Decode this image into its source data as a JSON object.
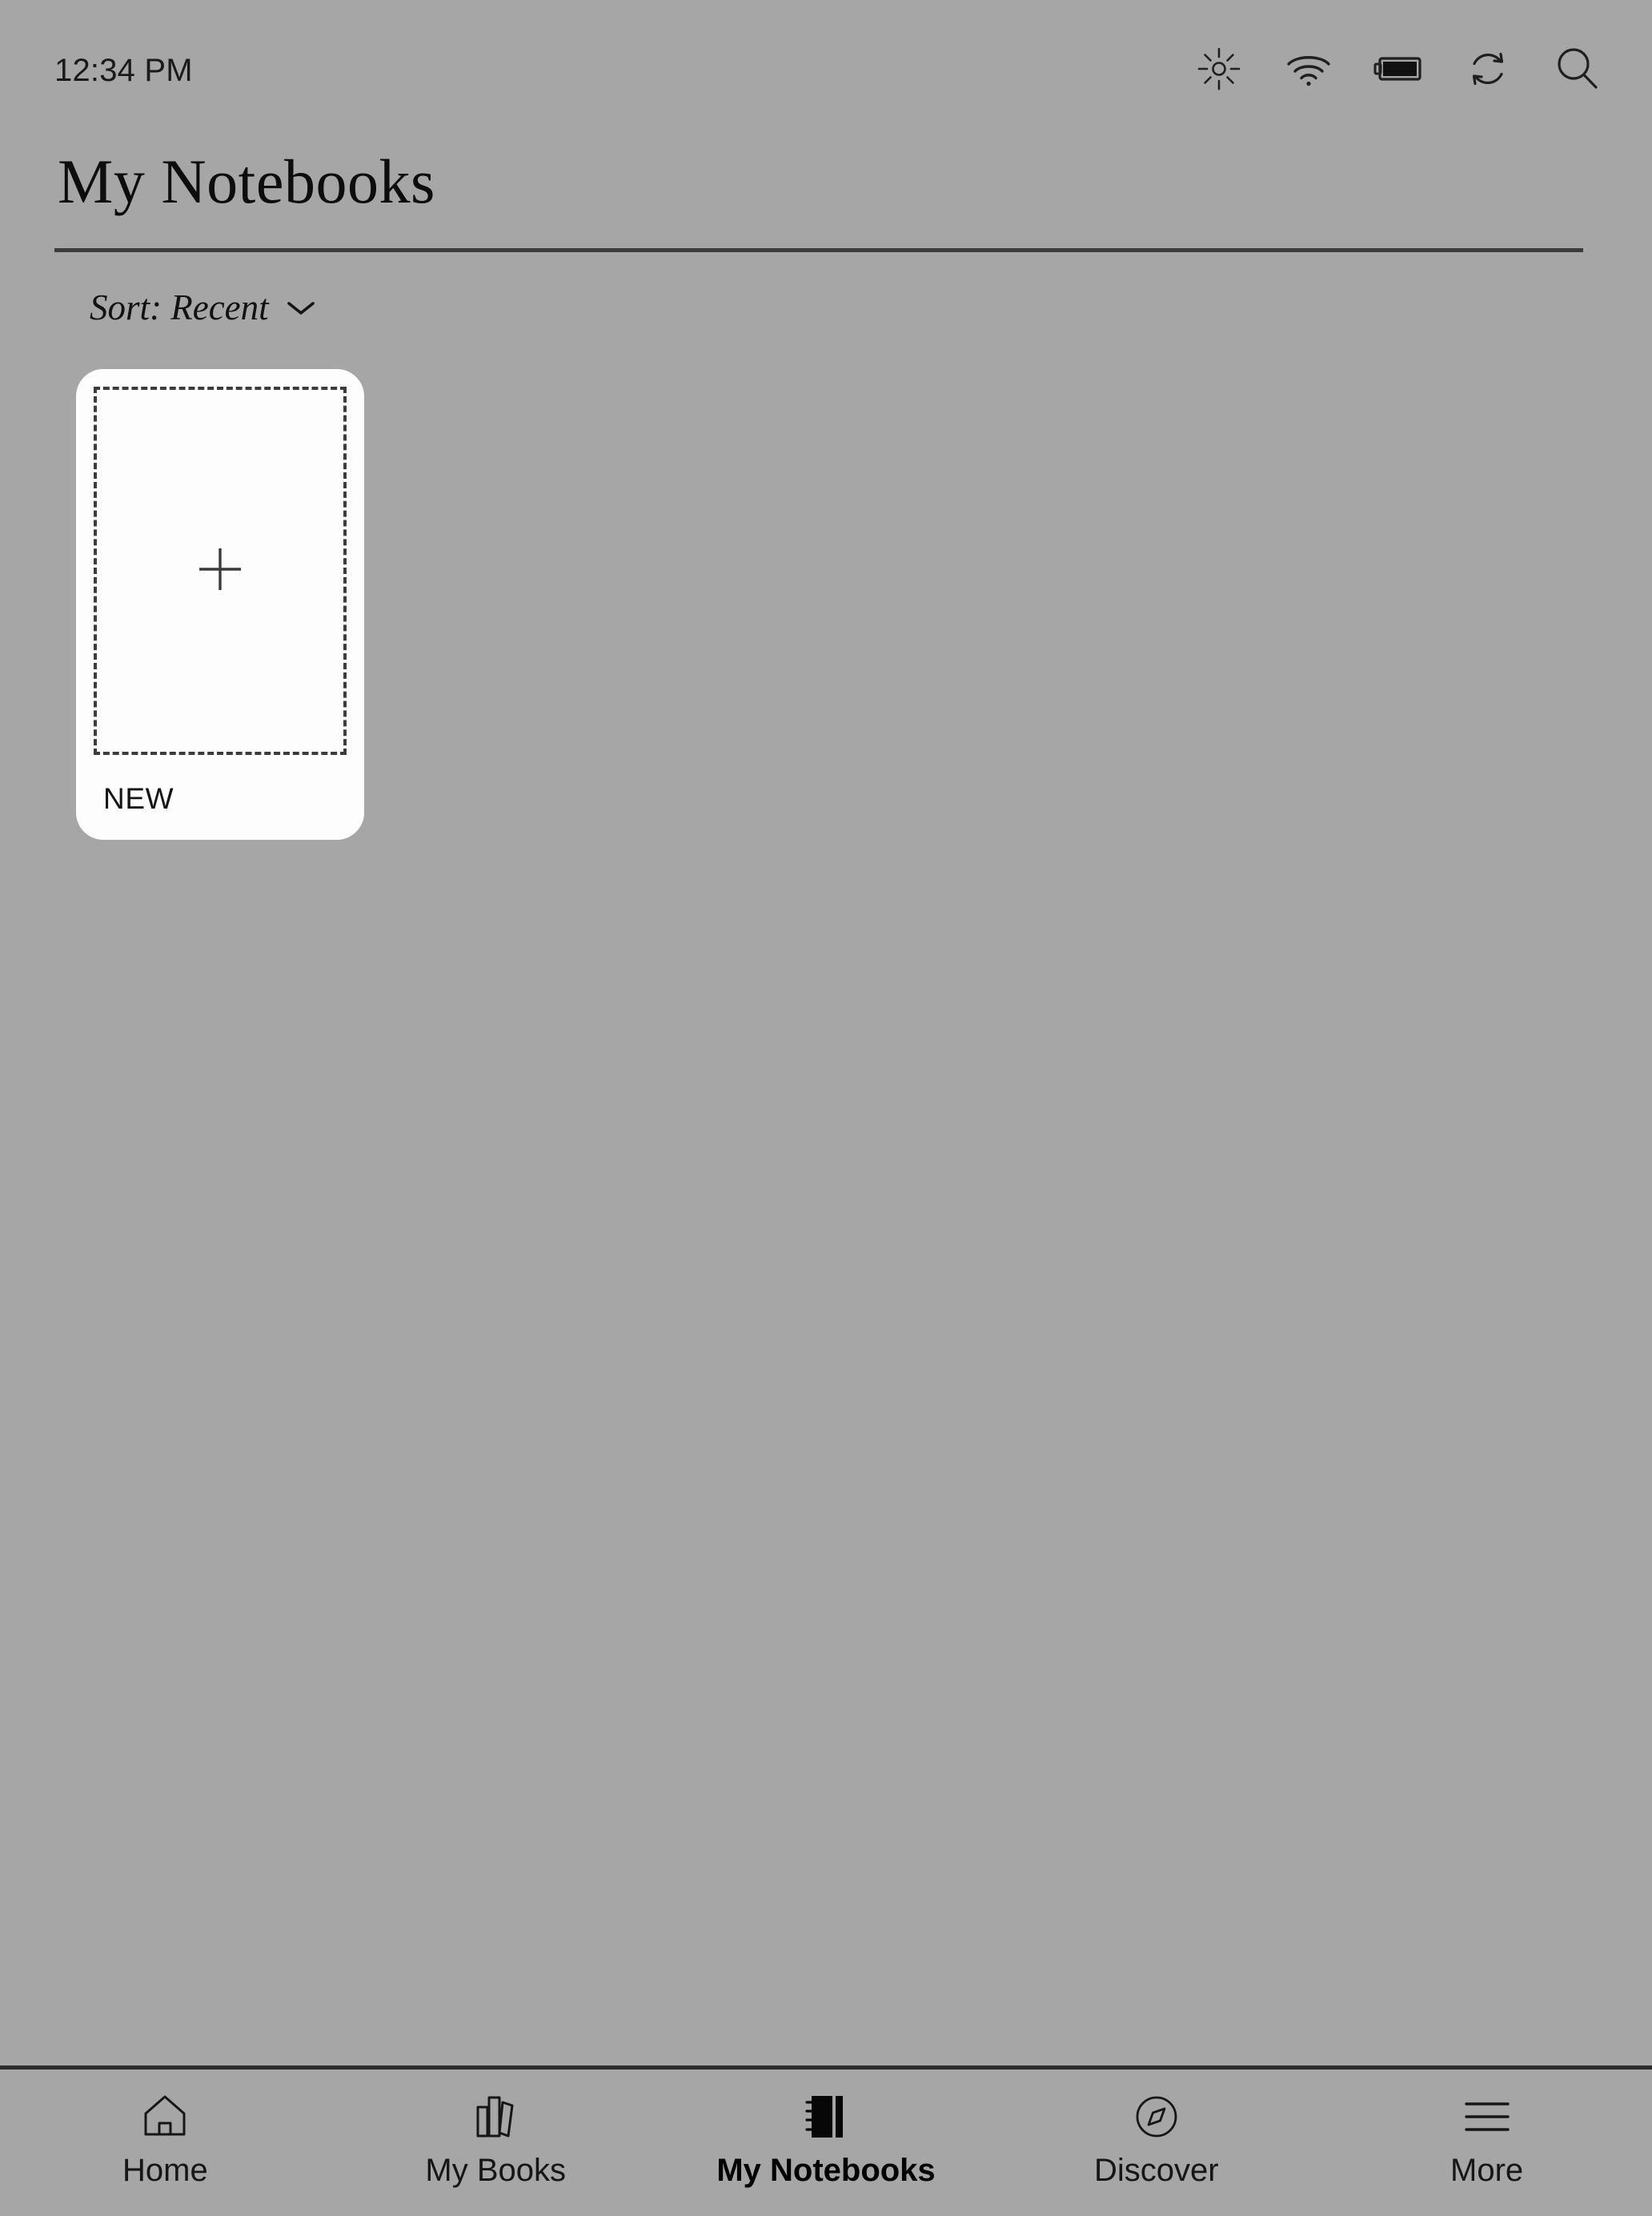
{
  "status_bar": {
    "time": "12:34 PM",
    "icons": [
      {
        "name": "brightness-icon",
        "label": "Brightness"
      },
      {
        "name": "wifi-icon",
        "label": "Wi-Fi"
      },
      {
        "name": "battery-icon",
        "label": "Battery"
      },
      {
        "name": "sync-icon",
        "label": "Sync"
      },
      {
        "name": "search-icon",
        "label": "Search"
      }
    ]
  },
  "header": {
    "title": "My Notebooks"
  },
  "sort": {
    "label": "Sort: Recent",
    "chevron": "chevron-down-icon"
  },
  "notebooks": {
    "new_card": {
      "plus": "plus-icon",
      "label": "NEW"
    },
    "items": []
  },
  "bottom_nav": {
    "items": [
      {
        "label": "Home",
        "icon": "home-icon",
        "active": false
      },
      {
        "label": "My Books",
        "icon": "books-icon",
        "active": false
      },
      {
        "label": "My Notebooks",
        "icon": "notebook-icon",
        "active": true
      },
      {
        "label": "Discover",
        "icon": "compass-icon",
        "active": false
      },
      {
        "label": "More",
        "icon": "hamburger-icon",
        "active": false
      }
    ]
  },
  "colors": {
    "background": "#a6a6a6",
    "card": "#fdfdfd",
    "ink": "#111111",
    "divider": "#3c3c3c"
  }
}
